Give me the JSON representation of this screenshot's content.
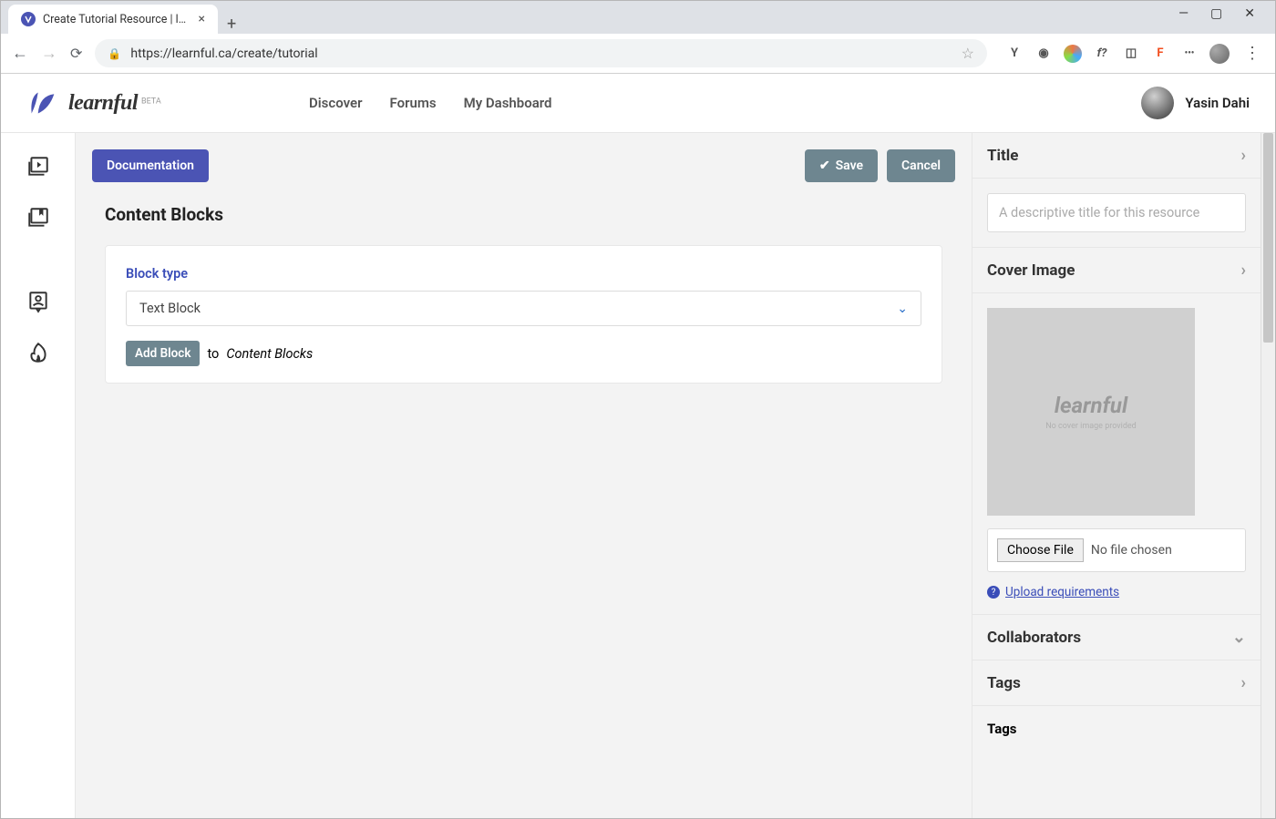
{
  "browser": {
    "tab_title": "Create Tutorial Resource | learnfu...",
    "url": "https://learnful.ca/create/tutorial",
    "new_tab": "+",
    "window": {
      "min": "—",
      "max": "▢",
      "close": "✕"
    }
  },
  "header": {
    "brand": "learnful",
    "beta": "BETA",
    "nav": {
      "discover": "Discover",
      "forums": "Forums",
      "dashboard": "My Dashboard"
    },
    "user_name": "Yasin Dahi"
  },
  "toolbar": {
    "documentation": "Documentation",
    "save": "Save",
    "cancel": "Cancel"
  },
  "main": {
    "section_title": "Content Blocks",
    "block_type_label": "Block type",
    "block_type_value": "Text Block",
    "add_block": "Add Block",
    "to_text": "to",
    "target": "Content Blocks"
  },
  "side": {
    "title": {
      "label": "Title",
      "placeholder": "A descriptive title for this resource"
    },
    "cover": {
      "label": "Cover Image",
      "placeholder_brand": "learnful",
      "placeholder_note": "No cover image provided",
      "choose_file": "Choose File",
      "no_file": "No file chosen",
      "upload_req": "Upload requirements"
    },
    "collaborators": {
      "label": "Collaborators"
    },
    "tags": {
      "label": "Tags",
      "sub": "Tags"
    }
  }
}
